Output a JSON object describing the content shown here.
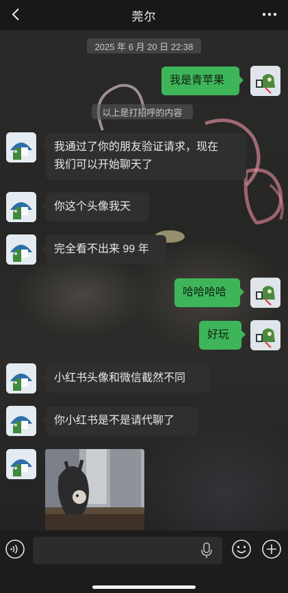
{
  "header": {
    "title": "莞尔",
    "back_icon": "chevron-left-icon",
    "more_icon": "ellipsis-icon"
  },
  "chat": {
    "timestamp": "2025 年 6 月 20 日 22:38",
    "system_notice": "以上是打招呼的内容",
    "messages": [
      {
        "side": "out",
        "text": "我是青苹果"
      },
      {
        "side": "in",
        "text_line1": "我通过了你的朋友验证请求，现在",
        "text_line2": "我们可以开始聊天了"
      },
      {
        "side": "in",
        "text": "你这个头像我天"
      },
      {
        "side": "in",
        "text": "完全看不出来 99 年"
      },
      {
        "side": "out",
        "text": "哈哈哈哈"
      },
      {
        "side": "out",
        "text": "好玩"
      },
      {
        "side": "in",
        "text": "小红书头像和微信截然不同"
      },
      {
        "side": "in",
        "text": "你小红书是不是请代聊了"
      },
      {
        "side": "in",
        "type": "image"
      }
    ]
  },
  "input_bar": {
    "voice_icon": "voice-mode-icon",
    "input_value": "",
    "mic_icon": "microphone-icon",
    "emoji_icon": "emoji-icon",
    "plus_icon": "plus-circle-icon"
  },
  "colors": {
    "out_bubble": "#3fb55a",
    "in_bubble": "#2f2f2f",
    "bar": "#181818"
  }
}
